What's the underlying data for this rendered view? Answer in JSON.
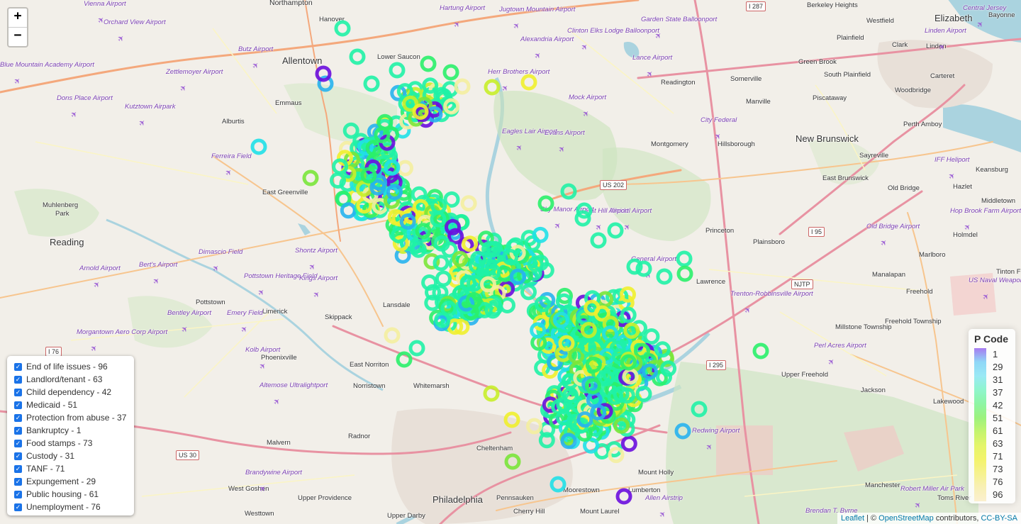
{
  "zoom": {
    "in_label": "+",
    "out_label": "−"
  },
  "layers": [
    {
      "label": "End of life issues - 96",
      "checked": true
    },
    {
      "label": "Landlord/tenant - 63",
      "checked": true
    },
    {
      "label": "Child dependency - 42",
      "checked": true
    },
    {
      "label": "Medicaid - 51",
      "checked": true
    },
    {
      "label": "Protection from abuse - 37",
      "checked": true
    },
    {
      "label": "Bankruptcy - 1",
      "checked": true
    },
    {
      "label": "Food stamps - 73",
      "checked": true
    },
    {
      "label": "Custody - 31",
      "checked": true
    },
    {
      "label": "TANF - 71",
      "checked": true
    },
    {
      "label": "Expungement - 29",
      "checked": true
    },
    {
      "label": "Public housing - 61",
      "checked": true
    },
    {
      "label": "Unemployment - 76",
      "checked": true
    }
  ],
  "legend": {
    "title": "P Code",
    "items": [
      {
        "label": "1",
        "color": "#a77bf0"
      },
      {
        "label": "29",
        "color": "#8fd7f7"
      },
      {
        "label": "31",
        "color": "#9ae9f5"
      },
      {
        "label": "37",
        "color": "#8ff5cc"
      },
      {
        "label": "42",
        "color": "#8ef5a4"
      },
      {
        "label": "51",
        "color": "#9cf27d"
      },
      {
        "label": "61",
        "color": "#c4f46e"
      },
      {
        "label": "63",
        "color": "#e4f56a"
      },
      {
        "label": "71",
        "color": "#f3f36b"
      },
      {
        "label": "73",
        "color": "#f6f28f"
      },
      {
        "label": "76",
        "color": "#f8f0b5"
      },
      {
        "label": "96",
        "color": "#fbf0cf"
      }
    ]
  },
  "marker_palette": {
    "violet": "#6a0dde",
    "blue": "#27b3ee",
    "cyan": "#20e0e8",
    "aqua": "#1ff2a6",
    "green": "#2af06a",
    "lime": "#7ae53a",
    "yellowgreen": "#c8ee2a",
    "yellow": "#f0f02e",
    "cream": "#f4eea0"
  },
  "places": [
    {
      "name": "Northampton",
      "cls": "mid"
    },
    {
      "name": "Hanover",
      "cls": "small"
    },
    {
      "name": "Allentown",
      "cls": "big"
    },
    {
      "name": "Lower Saucon",
      "cls": "small"
    },
    {
      "name": "Emmaus",
      "cls": "small"
    },
    {
      "name": "Alburtis",
      "cls": "small"
    },
    {
      "name": "East Greenville",
      "cls": "small"
    },
    {
      "name": "Muhlenberg",
      "cls": "small"
    },
    {
      "name": "Park",
      "cls": "small"
    },
    {
      "name": "Reading",
      "cls": "big"
    },
    {
      "name": "Pottstown",
      "cls": "small"
    },
    {
      "name": "Limerick",
      "cls": "small"
    },
    {
      "name": "Skippack",
      "cls": "small"
    },
    {
      "name": "Lansdale",
      "cls": "small"
    },
    {
      "name": "East Norriton",
      "cls": "small"
    },
    {
      "name": "Norristown",
      "cls": "small"
    },
    {
      "name": "Whitemarsh",
      "cls": "small"
    },
    {
      "name": "Phoenixville",
      "cls": "small"
    },
    {
      "name": "Malvern",
      "cls": "small"
    },
    {
      "name": "Radnor",
      "cls": "small"
    },
    {
      "name": "West Goshen",
      "cls": "small"
    },
    {
      "name": "Upper Providence",
      "cls": "small"
    },
    {
      "name": "Westtown",
      "cls": "small"
    },
    {
      "name": "Upper Darby",
      "cls": "small"
    },
    {
      "name": "Philadelphia",
      "cls": "big"
    },
    {
      "name": "Cheltenham",
      "cls": "small"
    },
    {
      "name": "Pennsauken",
      "cls": "small"
    },
    {
      "name": "Cherry Hill",
      "cls": "small"
    },
    {
      "name": "Mount Laurel",
      "cls": "small"
    },
    {
      "name": "Moorestown",
      "cls": "small"
    },
    {
      "name": "Lumberton",
      "cls": "small"
    },
    {
      "name": "Mount Holly",
      "cls": "small"
    },
    {
      "name": "Readington",
      "cls": "small"
    },
    {
      "name": "Somerville",
      "cls": "small"
    },
    {
      "name": "Manville",
      "cls": "small"
    },
    {
      "name": "Montgomery",
      "cls": "small"
    },
    {
      "name": "Hillsborough",
      "cls": "small"
    },
    {
      "name": "New Brunswick",
      "cls": "big"
    },
    {
      "name": "Princeton",
      "cls": "small"
    },
    {
      "name": "Plainsboro",
      "cls": "small"
    },
    {
      "name": "Lawrence",
      "cls": "small"
    },
    {
      "name": "Westfield",
      "cls": "small"
    },
    {
      "name": "Plainfield",
      "cls": "small"
    },
    {
      "name": "Clark",
      "cls": "small"
    },
    {
      "name": "Green Brook",
      "cls": "small"
    },
    {
      "name": "South Plainfield",
      "cls": "small"
    },
    {
      "name": "Piscataway",
      "cls": "small"
    },
    {
      "name": "Woodbridge",
      "cls": "small"
    },
    {
      "name": "Carteret",
      "cls": "small"
    },
    {
      "name": "Perth Amboy",
      "cls": "small"
    },
    {
      "name": "Sayreville",
      "cls": "small"
    },
    {
      "name": "East Brunswick",
      "cls": "small"
    },
    {
      "name": "Old Bridge",
      "cls": "small"
    },
    {
      "name": "Hazlet",
      "cls": "small"
    },
    {
      "name": "Middletown",
      "cls": "small"
    },
    {
      "name": "Holmdel",
      "cls": "small"
    },
    {
      "name": "Marlboro",
      "cls": "small"
    },
    {
      "name": "Manalapan",
      "cls": "small"
    },
    {
      "name": "Freehold",
      "cls": "small"
    },
    {
      "name": "Freehold Township",
      "cls": "small"
    },
    {
      "name": "Millstone Township",
      "cls": "small"
    },
    {
      "name": "Upper Freehold",
      "cls": "small"
    },
    {
      "name": "Jackson",
      "cls": "small"
    },
    {
      "name": "Lakewood",
      "cls": "small"
    },
    {
      "name": "Manchester",
      "cls": "small"
    },
    {
      "name": "Toms River",
      "cls": "small"
    },
    {
      "name": "Elizabeth",
      "cls": "big"
    },
    {
      "name": "Bayonne",
      "cls": "small"
    },
    {
      "name": "Berkeley Heights",
      "cls": "small"
    },
    {
      "name": "Linden",
      "cls": "small"
    },
    {
      "name": "Keansburg",
      "cls": "small"
    },
    {
      "name": "Tinton F",
      "cls": "small"
    }
  ],
  "airports": [
    "Orchard View Airport",
    "Butz Airport",
    "Blue Mountain Academy Airport",
    "Zettlemoyer Airport",
    "Dons Place Airport",
    "Kutztown Airpark",
    "Ferreira Field",
    "Alexandria Airport",
    "Herr Brothers Airport",
    "Eagles Lair Airport",
    "Evans Airport",
    "Mock Airport",
    "Lance Airport",
    "Garden State Balloonport",
    "Clinton Elks Lodge Balloonport",
    "Arnold Airport",
    "Bert's Airport",
    "Dimascio Field",
    "Shontz Airport",
    "Pottstown Heritage Field",
    "Kings Airport",
    "Bentley Airport",
    "Emery Field",
    "Morgantown Aero Corp Airport",
    "Kolb Airport",
    "Altemose Ultralightport",
    "Brandywine Airport",
    "City Federal",
    "Trenton-Robbinsville Airport",
    "Perl Acres Airport",
    "Redwing Airport",
    "Allen Airstrip",
    "IFF Heliport",
    "Hop Brook Farm Airport",
    "Old Bridge Airport",
    "US Naval Weapons Station Earle",
    "Robert Miller Air Park",
    "Brendan T. Byrne",
    "Weidel Airport",
    "Goat Hill Airport",
    "Sky Manor Airport",
    "Hartung Airport",
    "Jugtown Mountain Airport",
    "Vienna Airport",
    "Linden Airport",
    "Central Jersey",
    "General Airport"
  ],
  "shields": [
    "I 287",
    "US 202",
    "I 95",
    "NJTP",
    "I 76",
    "US 30",
    "I 295"
  ],
  "attribution": {
    "leaflet": "Leaflet",
    "sep": " | © ",
    "osm": "OpenStreetMap",
    "contrib": " contributors, ",
    "license": "CC-BY-SA"
  }
}
